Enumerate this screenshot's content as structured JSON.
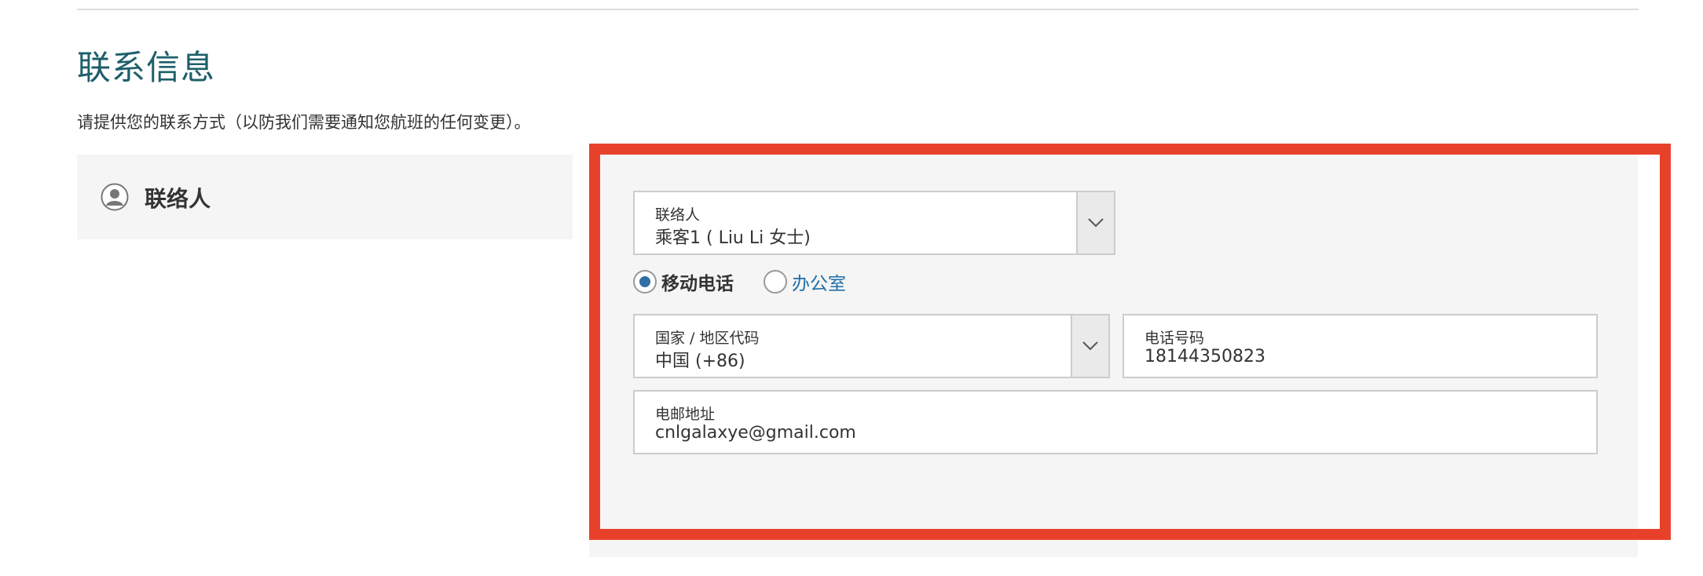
{
  "section": {
    "title": "联系信息",
    "description": "请提供您的联系方式（以防我们需要通知您航班的任何变更）。"
  },
  "contact_card": {
    "heading": "联络人",
    "icon": "person-icon"
  },
  "form": {
    "contact_person": {
      "label": "联络人",
      "value": "乘客1 ( Liu Li 女士)"
    },
    "phone_type": {
      "options": [
        {
          "label": "移动电话",
          "selected": true
        },
        {
          "label": "办公室",
          "selected": false
        }
      ]
    },
    "country_code": {
      "label": "国家 / 地区代码",
      "value": "中国 (+86)"
    },
    "phone_number": {
      "label": "电话号码",
      "value": "18144350823"
    },
    "email": {
      "label": "电邮地址",
      "value": "cnlgalaxye@gmail.com"
    }
  },
  "colors": {
    "title": "#1d5f6a",
    "highlight_border": "#e8412b",
    "radio_selected": "#2f6fa3",
    "link_text": "#1f6fa8",
    "panel_background": "#f5f5f5"
  }
}
